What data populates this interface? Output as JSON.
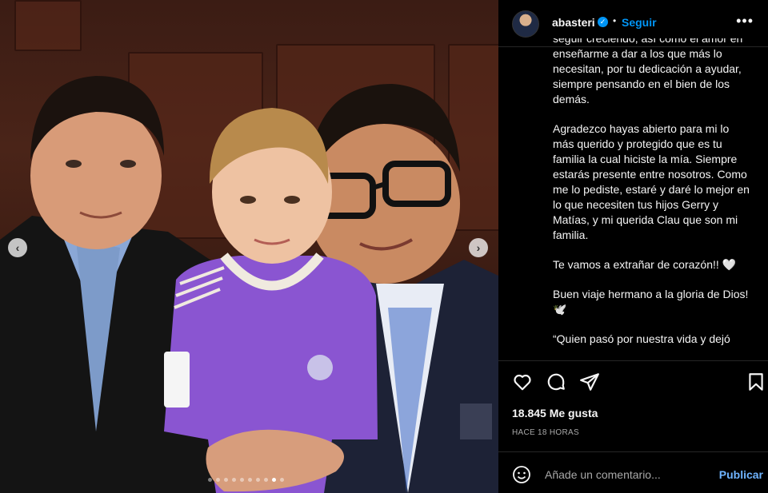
{
  "post": {
    "username": "abasteri",
    "verified_mark": "✓",
    "bullet": "•",
    "follow_label": "Seguir",
    "more_label": "•••",
    "caption_paragraphs": [
      "seguir creciendo, así como el amor en enseñarme a dar a los que más lo necesitan, por tu dedicación a ayudar, siempre pensando en el bien de los demás.",
      "Agradezco hayas abierto para mi lo más querido y protegido que es tu familia la cual hiciste la mía. Siempre estarás presente entre nosotros. Como me lo pediste, estaré y daré lo mejor en lo que necesiten tus hijos Gerry y Matías, y mi querida Clau que son mi familia.",
      "Te vamos a extrañar de corazón!! 🤍",
      "Buen viaje hermano a la gloria de Dios! 🕊️",
      "“Quien pasó por nuestra vida y dejó"
    ],
    "likes": "18.845 Me gusta",
    "time_ago": "HACE 18 HORAS",
    "comment_placeholder": "Añade un comentario...",
    "publish_label": "Publicar"
  },
  "carousel": {
    "prev_icon": "‹",
    "next_icon": "›",
    "dot_count": 10,
    "active_index": 8
  },
  "colors": {
    "accent": "#0095f6",
    "publish": "#6fb4ff",
    "muted": "#a8a8a8",
    "background": "#000000"
  },
  "icons": [
    "heart-icon",
    "comment-icon",
    "share-icon",
    "bookmark-icon",
    "emoji-icon",
    "more-icon",
    "verified-icon"
  ]
}
